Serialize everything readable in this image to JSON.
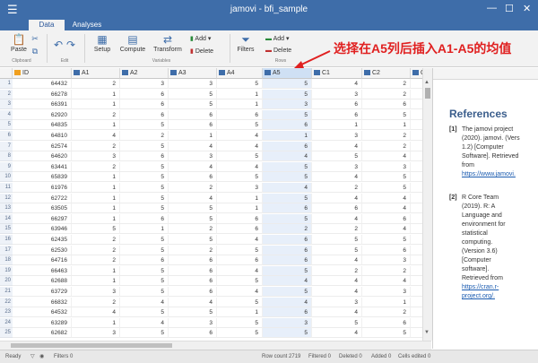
{
  "window": {
    "title": "jamovi - bfi_sample",
    "menu_icon": "hamburger-icon"
  },
  "tabs": [
    {
      "label": "Data",
      "active": true
    },
    {
      "label": "Analyses",
      "active": false
    }
  ],
  "ribbon": {
    "paste": "Paste",
    "clipboard": "Clipboard",
    "edit": "Edit",
    "setup": "Setup",
    "compute": "Compute",
    "transform": "Transform",
    "add": "Add",
    "delete": "Delete",
    "variables": "Variables",
    "filters": "Filters",
    "add2": "Add",
    "delete2": "Delete",
    "rows": "Rows"
  },
  "annotation": "选择在A5列后插入A1-A5的均值",
  "columns": [
    {
      "name": "ID",
      "icon": "id-icon"
    },
    {
      "name": "A1",
      "icon": "ordinal-icon"
    },
    {
      "name": "A2",
      "icon": "ordinal-icon"
    },
    {
      "name": "A3",
      "icon": "ordinal-icon"
    },
    {
      "name": "A4",
      "icon": "ordinal-icon"
    },
    {
      "name": "A5",
      "icon": "ordinal-icon",
      "selected": true
    },
    {
      "name": "C1",
      "icon": "ordinal-icon"
    },
    {
      "name": "C2",
      "icon": "ordinal-icon"
    },
    {
      "name": "C3",
      "icon": "ordinal-icon"
    }
  ],
  "rows": [
    [
      "64432",
      "2",
      "3",
      "3",
      "5",
      "5",
      "4",
      "2",
      ""
    ],
    [
      "66278",
      "1",
      "6",
      "5",
      "1",
      "5",
      "3",
      "2",
      ""
    ],
    [
      "66391",
      "1",
      "6",
      "5",
      "1",
      "3",
      "6",
      "6",
      ""
    ],
    [
      "62920",
      "2",
      "6",
      "6",
      "6",
      "5",
      "6",
      "5",
      ""
    ],
    [
      "64835",
      "1",
      "5",
      "6",
      "5",
      "6",
      "1",
      "1",
      ""
    ],
    [
      "64810",
      "4",
      "2",
      "1",
      "4",
      "1",
      "3",
      "2",
      ""
    ],
    [
      "62574",
      "2",
      "5",
      "4",
      "4",
      "6",
      "4",
      "2",
      ""
    ],
    [
      "64620",
      "3",
      "6",
      "3",
      "5",
      "4",
      "5",
      "4",
      ""
    ],
    [
      "63441",
      "2",
      "5",
      "4",
      "4",
      "5",
      "3",
      "3",
      ""
    ],
    [
      "65839",
      "1",
      "5",
      "6",
      "5",
      "5",
      "4",
      "5",
      ""
    ],
    [
      "61976",
      "1",
      "5",
      "2",
      "3",
      "4",
      "2",
      "5",
      ""
    ],
    [
      "62722",
      "1",
      "5",
      "4",
      "1",
      "5",
      "4",
      "4",
      ""
    ],
    [
      "63505",
      "1",
      "5",
      "5",
      "1",
      "6",
      "6",
      "4",
      ""
    ],
    [
      "66297",
      "1",
      "6",
      "5",
      "6",
      "5",
      "4",
      "6",
      ""
    ],
    [
      "63946",
      "5",
      "1",
      "2",
      "6",
      "2",
      "2",
      "4",
      ""
    ],
    [
      "62435",
      "2",
      "5",
      "5",
      "4",
      "6",
      "5",
      "5",
      ""
    ],
    [
      "62530",
      "2",
      "5",
      "2",
      "5",
      "6",
      "5",
      "6",
      ""
    ],
    [
      "64716",
      "2",
      "6",
      "6",
      "6",
      "6",
      "4",
      "3",
      ""
    ],
    [
      "66463",
      "1",
      "5",
      "6",
      "4",
      "5",
      "2",
      "2",
      ""
    ],
    [
      "62688",
      "1",
      "5",
      "6",
      "5",
      "4",
      "4",
      "4",
      ""
    ],
    [
      "63729",
      "3",
      "5",
      "6",
      "4",
      "5",
      "4",
      "3",
      ""
    ],
    [
      "66832",
      "2",
      "4",
      "4",
      "5",
      "4",
      "3",
      "1",
      ""
    ],
    [
      "64532",
      "4",
      "5",
      "5",
      "1",
      "6",
      "4",
      "2",
      ""
    ],
    [
      "63289",
      "1",
      "4",
      "3",
      "5",
      "3",
      "5",
      "6",
      ""
    ],
    [
      "62682",
      "3",
      "5",
      "6",
      "5",
      "5",
      "4",
      "5",
      ""
    ]
  ],
  "results": {
    "heading": "References",
    "refs": [
      {
        "num": "[1]",
        "lines": [
          "The jamovi project",
          "(2020). jamovi. (Vers",
          "1.2) [Computer",
          "Software]. Retrieved",
          "from"
        ],
        "link": "https://www.jamovi."
      },
      {
        "num": "[2]",
        "lines": [
          "R Core Team",
          "(2019). R: A",
          "Language and",
          "environment for",
          "statistical",
          "computing.",
          "(Version 3.6)",
          "[Computer",
          "software].",
          "Retrieved from"
        ],
        "link": "https://cran.r-",
        "link2": "project.org/."
      }
    ]
  },
  "status": {
    "ready": "Ready",
    "filters": "Filters 0",
    "row_count": "Row count 2719",
    "filtered": "Filtered 0",
    "deleted": "Deleted 0",
    "added": "Added 0",
    "edited": "Cells edited 0"
  }
}
